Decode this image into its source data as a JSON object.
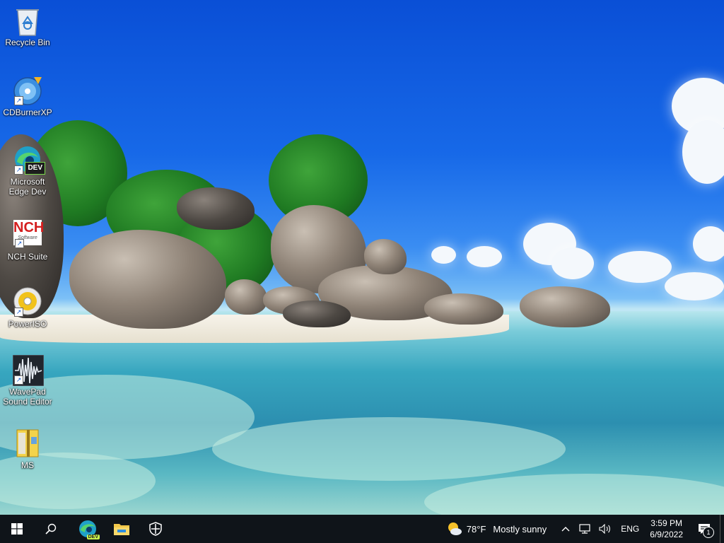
{
  "desktop": {
    "icons": [
      {
        "label": "Recycle Bin"
      },
      {
        "label": "CDBurnerXP"
      },
      {
        "label_line1": "Microsoft",
        "label_line2": "Edge Dev",
        "badge": "DEV"
      },
      {
        "label": "NCH Suite",
        "logo_text": "NCH",
        "logo_sub": "Software"
      },
      {
        "label": "PowerISO"
      },
      {
        "label_line1": "WavePad",
        "label_line2": "Sound Editor"
      },
      {
        "label": "MS"
      }
    ]
  },
  "taskbar": {
    "start_icon": "windows-logo-icon",
    "search_icon": "search-icon",
    "pinned": [
      {
        "name": "edge-dev-icon",
        "badge": "DEV"
      },
      {
        "name": "file-explorer-icon"
      },
      {
        "name": "windows-security-icon"
      }
    ],
    "weather": {
      "temp": "78°F",
      "condition": "Mostly sunny"
    },
    "tray": {
      "language": "ENG",
      "time": "3:59 PM",
      "date": "6/9/2022",
      "notification_count": "1"
    }
  },
  "colors": {
    "taskbar_bg": "#0f1419",
    "sky": "#1769e8"
  }
}
